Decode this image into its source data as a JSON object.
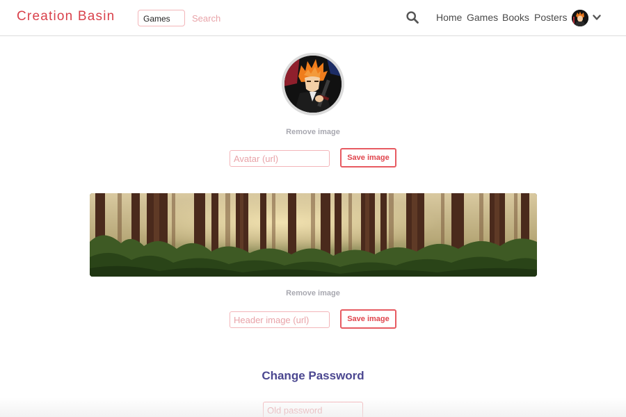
{
  "app": {
    "brand": "Creation Basin"
  },
  "nav": {
    "category_selected": "Games",
    "search_placeholder": "Search",
    "search_icon": "magnifier-icon",
    "links": [
      "Home",
      "Games",
      "Books",
      "Posters"
    ],
    "user_menu_icon": "chevron-down-icon"
  },
  "profile": {
    "avatar": {
      "remove_label": "Remove image",
      "url_placeholder": "Avatar (url)",
      "save_label": "Save image"
    },
    "header": {
      "remove_label": "Remove image",
      "url_placeholder": "Header image (url)",
      "save_label": "Save image"
    }
  },
  "password": {
    "title": "Change Password",
    "old_placeholder": "Old password"
  },
  "colors": {
    "brand": "#d9414b",
    "accent_border": "#e75a61",
    "input_border": "#f3b5b9",
    "section_title": "#4b4790",
    "muted_link": "#a8a8b0"
  }
}
